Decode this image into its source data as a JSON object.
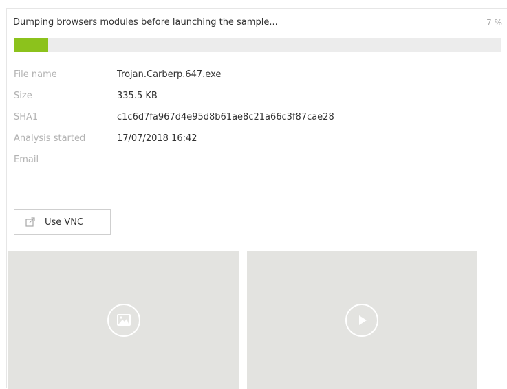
{
  "status": {
    "message": "Dumping browsers modules before launching the sample...",
    "percent_label": "7 %",
    "progress_fraction": 0.07,
    "progress_color": "#8cc21c"
  },
  "file_info": [
    {
      "label": "File name",
      "value": "Trojan.Carberp.647.exe"
    },
    {
      "label": "Size",
      "value": "335.5 KB"
    },
    {
      "label": "SHA1",
      "value": "c1c6d7fa967d4e95d8b61ae8c21a66c3f87cae28"
    },
    {
      "label": "Analysis started",
      "value": "17/07/2018 16:42"
    },
    {
      "label": "Email",
      "value": ""
    }
  ],
  "actions": {
    "vnc_label": "Use VNC",
    "vnc_icon": "external-link-icon"
  },
  "media": {
    "screenshots_icon": "image-icon",
    "video_icon": "play-icon"
  }
}
